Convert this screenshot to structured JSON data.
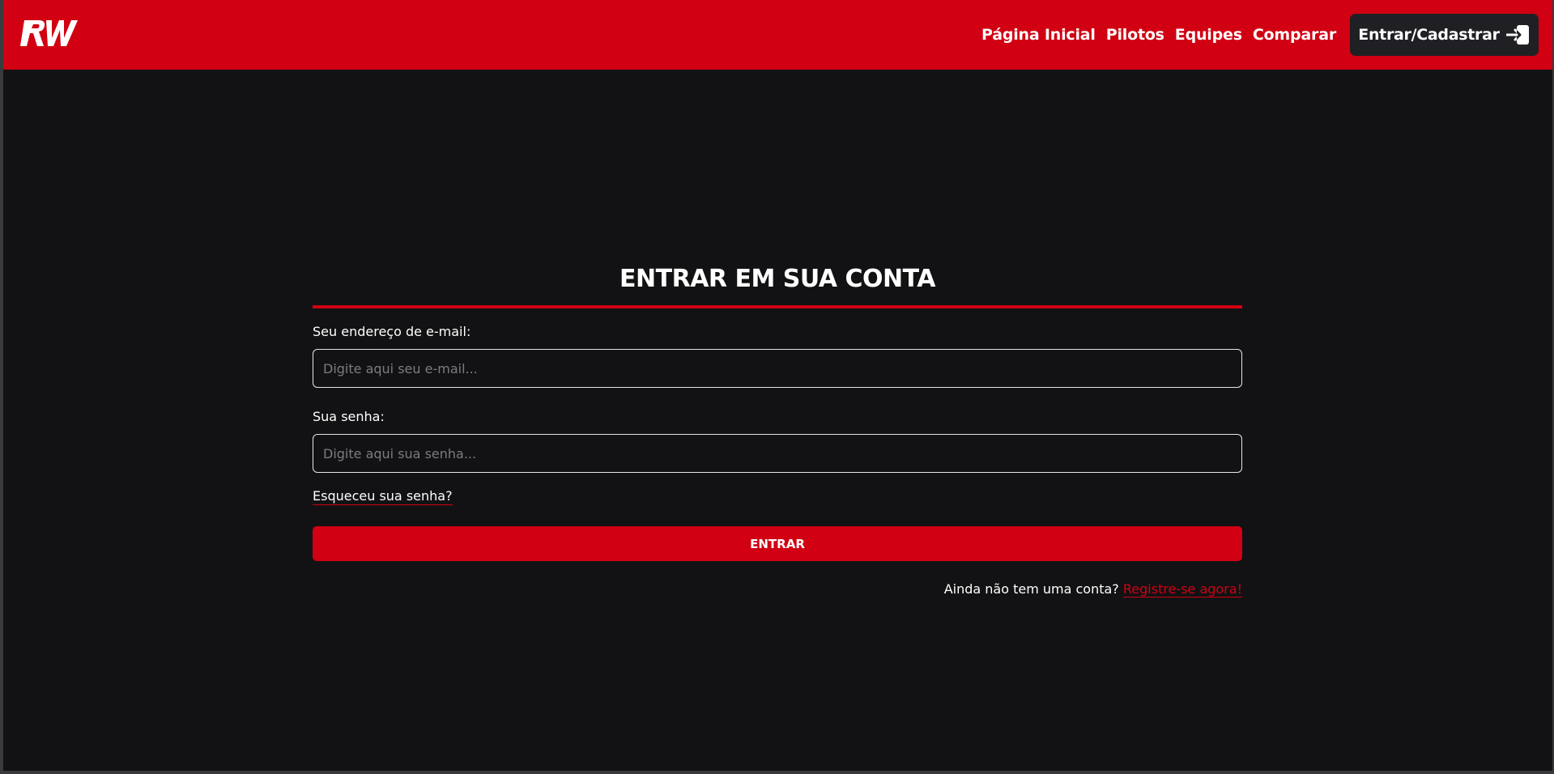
{
  "brand": {
    "logo_text": "RW",
    "primary_color": "#d10012",
    "background_color": "#121214",
    "button_dark_color": "#202024"
  },
  "nav": {
    "links": [
      {
        "label": "Página Inicial"
      },
      {
        "label": "Pilotos"
      },
      {
        "label": "Equipes"
      },
      {
        "label": "Comparar"
      }
    ],
    "login_button": {
      "label": "Entrar/Cadastrar",
      "icon": "login-arrow-icon"
    }
  },
  "login_form": {
    "title": "ENTRAR EM SUA CONTA",
    "email": {
      "label": "Seu endereço de e-mail:",
      "placeholder": "Digite aqui seu e-mail...",
      "value": ""
    },
    "password": {
      "label": "Sua senha:",
      "placeholder": "Digite aqui sua senha...",
      "value": ""
    },
    "forgot_password": "Esqueceu sua senha?",
    "submit_label": "ENTRAR",
    "register_prompt": "Ainda não tem uma conta?",
    "register_link": "Registre-se agora!"
  }
}
